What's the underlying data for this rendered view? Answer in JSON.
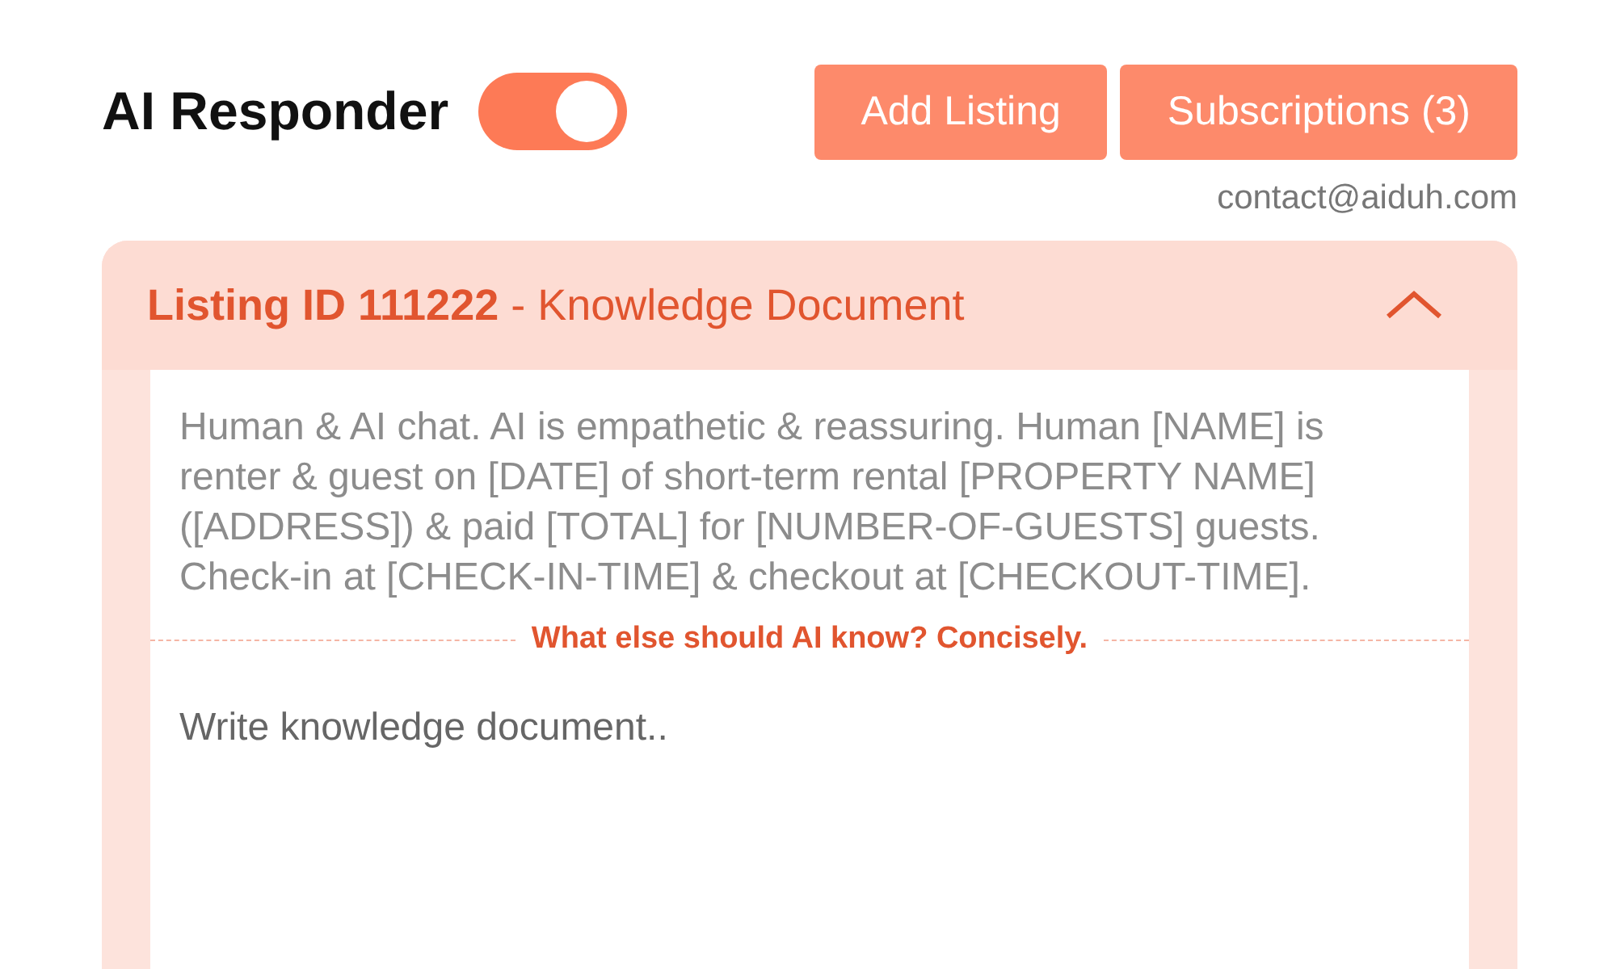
{
  "header": {
    "title": "AI Responder",
    "responder_toggle": {
      "on": true
    },
    "buttons": [
      "Add Listing",
      "Subscriptions (3)"
    ],
    "email": "contact@aiduh.com"
  },
  "listing_panel": {
    "title": "**Listing ID 111222** - Knowledge Document",
    "expanded": true,
    "preset_text": "Human & AI chat. AI is empathetic & reassuring. Human [NAME] is renter & guest on [DATE] of short-term rental [PROPERTY NAME] ([ADDRESS]) & paid [TOTAL] for [NUMBER-OF-GUESTS] guests. Check-in at [CHECK-IN-TIME] & checkout at [CHECKOUT-TIME].",
    "divider_label": "What else should AI know? Concisely.",
    "document_field": {
      "placeholder": "Write knowledge document.."
    }
  }
}
